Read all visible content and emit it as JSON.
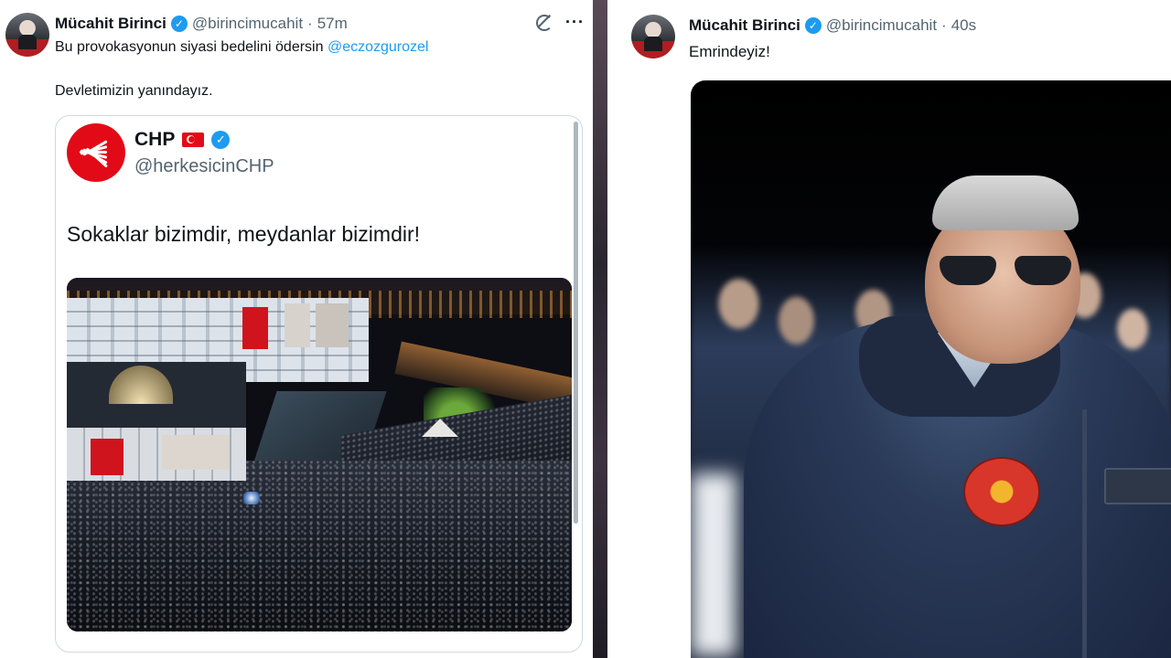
{
  "left_tweet": {
    "author_name": "Mücahit Birinci",
    "verified_glyph": "✓",
    "handle": "@birincimucahit",
    "separator": "·",
    "time": "57m",
    "text_line1": "Bu provokasyonun siyasi bedelini ödersin",
    "mention": "@eczozgurozel",
    "text_line2": "Devletimizin yanındayız.",
    "more_glyph": "···",
    "quoted": {
      "author_name": "CHP",
      "verified_glyph": "✓",
      "handle": "@herkesicinCHP",
      "text": "Sokaklar bizimdir, meydanlar bizimdir!"
    }
  },
  "right_tweet": {
    "author_name": "Mücahit Birinci",
    "verified_glyph": "✓",
    "handle": "@birincimucahit",
    "separator": "·",
    "time": "40s",
    "text": "Emrindeyiz!"
  },
  "icons": {
    "avatar": "avatar-photo",
    "verified": "verified-badge-icon",
    "grok": "grok-icon",
    "more": "more-icon",
    "flag": "turkey-flag-icon",
    "chp_logo": "chp-logo"
  },
  "colors": {
    "link": "#1d9bf0",
    "verified": "#1d9bf0",
    "secondary_text": "#536471",
    "chp_red": "#e30a17"
  }
}
